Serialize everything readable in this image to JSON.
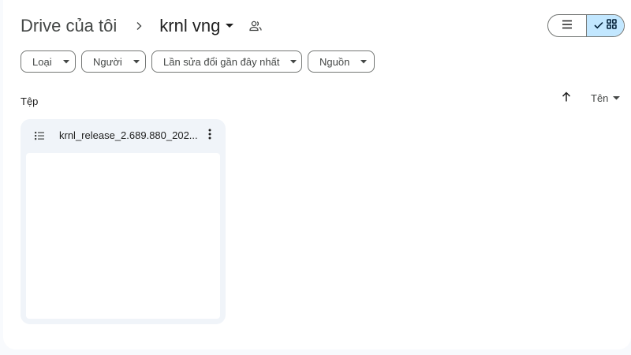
{
  "breadcrumb": {
    "root": "Drive của tôi",
    "current": "krnl vng",
    "separator_icon": "chevron-right-icon",
    "caret_icon": "caret-down-icon",
    "shared_icon": "shared-folder-icon"
  },
  "view_toggle": {
    "list_icon": "list-view-icon",
    "grid_icon": "grid-view-icon",
    "active": "grid"
  },
  "filters": [
    {
      "label": "Loại"
    },
    {
      "label": "Người"
    },
    {
      "label": "Lần sửa đổi gần đây nhất"
    },
    {
      "label": "Nguồn"
    }
  ],
  "section": {
    "title": "Tệp",
    "sort_direction_icon": "arrow-up-icon",
    "sort_by": "Tên"
  },
  "files": [
    {
      "name": "krnl_release_2.689.880_202...",
      "icon": "text-file-icon"
    }
  ],
  "colors": {
    "accent": "#c2e7ff",
    "card_bg": "#f0f4f9",
    "page_bg": "#f8fafd"
  }
}
